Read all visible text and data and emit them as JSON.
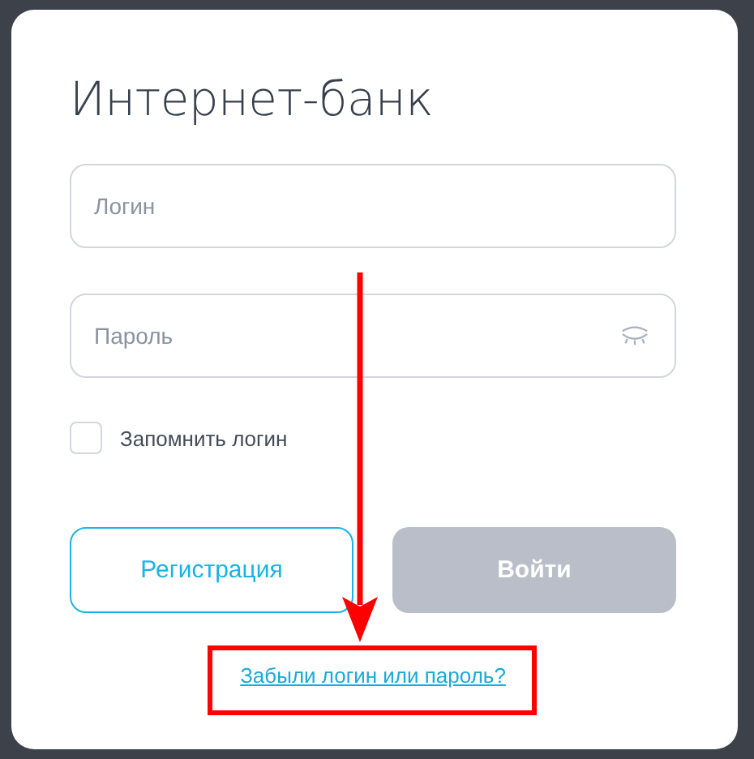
{
  "title": "Интернет-банк",
  "fields": [
    {
      "kind": "text",
      "placeholder": "Логин"
    },
    {
      "kind": "password",
      "placeholder": "Пароль"
    }
  ],
  "remember": {
    "label": "Запомнить логин",
    "checked": false
  },
  "buttons": [
    {
      "kind": "outline",
      "label": "Регистрация",
      "disabled": false
    },
    {
      "kind": "primary",
      "label": "Войти",
      "disabled": true
    }
  ],
  "forgot_link": "Забыли логин или пароль?"
}
